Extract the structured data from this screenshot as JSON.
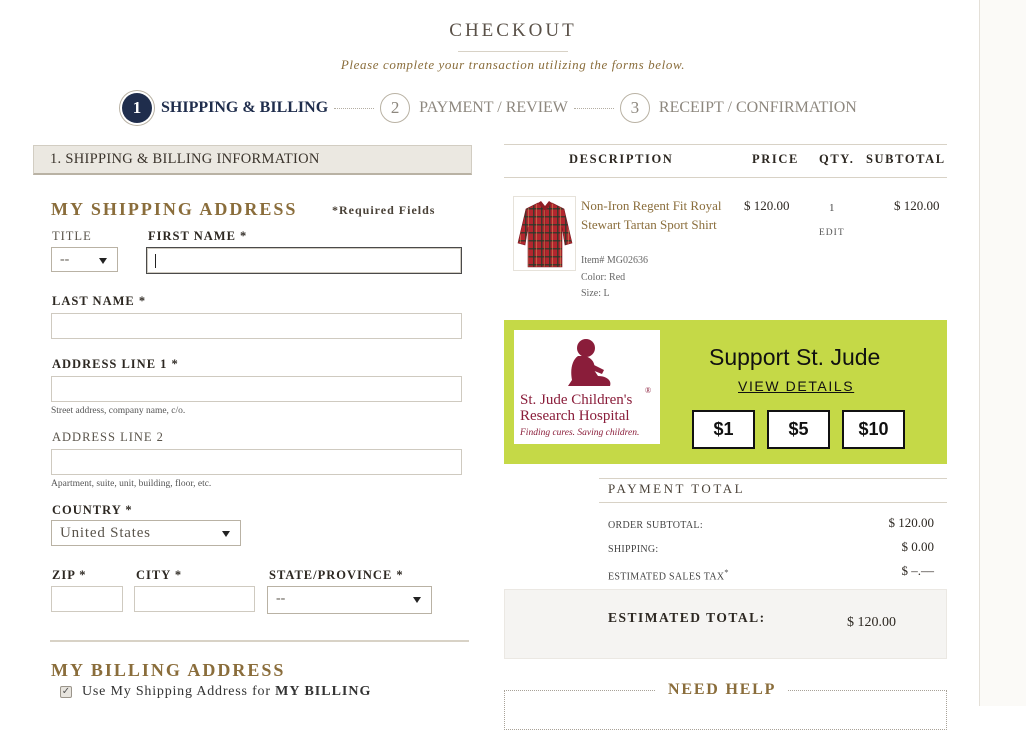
{
  "header": {
    "title": "CHECKOUT",
    "subtitle": "Please complete your transaction utilizing the forms below."
  },
  "steps": [
    {
      "number": "1",
      "label": "SHIPPING & BILLING",
      "active": true
    },
    {
      "number": "2",
      "label": "PAYMENT / REVIEW",
      "active": false
    },
    {
      "number": "3",
      "label": "RECEIPT / CONFIRMATION",
      "active": false
    }
  ],
  "section": {
    "title": "1. SHIPPING & BILLING INFORMATION"
  },
  "shipping": {
    "heading": "MY SHIPPING ADDRESS",
    "required_note": "*Required Fields",
    "title_label": "TITLE",
    "title_value": "--",
    "first_name_label": "FIRST NAME",
    "last_name_label": "LAST NAME",
    "address1_label": "ADDRESS LINE 1",
    "address1_hint": "Street address, company name, c/o.",
    "address2_label": "ADDRESS LINE 2",
    "address2_hint": "Apartment, suite, unit, building, floor, etc.",
    "country_label": "COUNTRY",
    "country_value": "United States",
    "zip_label": "ZIP",
    "city_label": "CITY",
    "state_label": "STATE/PROVINCE",
    "state_value": "--",
    "required_marker": "*"
  },
  "billing": {
    "heading": "MY BILLING ADDRESS",
    "checkbox_checked": true,
    "checkbox_label_prefix": "Use My Shipping Address for",
    "checkbox_label_bold": "MY BILLING"
  },
  "cart": {
    "headers": {
      "description": "DESCRIPTION",
      "price": "PRICE",
      "qty": "QTY.",
      "subtotal": "SUBTOTAL"
    },
    "items": [
      {
        "name": "Non-Iron Regent Fit Royal Stewart Tartan Sport Shirt",
        "item_no": "Item# MG02636",
        "color": "Color: Red",
        "size": "Size: L",
        "price": "$ 120.00",
        "qty": "1",
        "edit_label": "EDIT",
        "subtotal": "$ 120.00"
      }
    ]
  },
  "donation": {
    "logo_line1": "St. Jude Children's",
    "logo_line2": "Research Hospital",
    "logo_tagline": "Finding cures. Saving children.",
    "logo_reg": "®",
    "title": "Support St. Jude",
    "link": "VIEW DETAILS",
    "amounts": [
      "$1",
      "$5",
      "$10"
    ],
    "bg_color": "#c5d947"
  },
  "payment_total": {
    "title": "PAYMENT TOTAL",
    "order_subtotal_label": "ORDER SUBTOTAL:",
    "order_subtotal": "$ 120.00",
    "shipping_label": "SHIPPING:",
    "shipping": "$ 0.00",
    "tax_label": "ESTIMATED SALES TAX",
    "tax_marker": "*",
    "tax": "$ –.––",
    "estimated_total_label": "ESTIMATED TOTAL:",
    "estimated_total": "$ 120.00"
  },
  "help": {
    "title": "NEED HELP"
  },
  "colors": {
    "navy": "#1f2d4c",
    "gold": "#8a6d3b",
    "stjude_red": "#8a1d3a"
  }
}
